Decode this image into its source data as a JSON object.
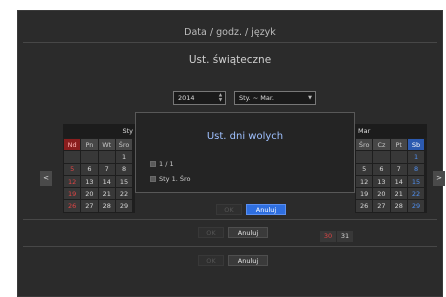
{
  "header": {
    "title": "Data / godz. / język"
  },
  "holiday": {
    "title": "Ust. świąteczne",
    "year": "2014",
    "month_range": "Sty. ~ Mar."
  },
  "cal_left": {
    "month_label": "Sty",
    "weekday_headers": [
      "Nd",
      "Pn",
      "Wt",
      "Śro"
    ],
    "rows": [
      [
        "",
        "",
        "",
        "1"
      ],
      [
        "5",
        "6",
        "7",
        "8"
      ],
      [
        "12",
        "13",
        "14",
        "15"
      ],
      [
        "19",
        "20",
        "21",
        "22"
      ],
      [
        "26",
        "27",
        "28",
        "29"
      ]
    ]
  },
  "cal_right": {
    "month_label": "Mar",
    "weekday_headers": [
      "Śro",
      "Cz",
      "Pt",
      "Sb"
    ],
    "rows": [
      [
        "",
        "",
        "",
        "1"
      ],
      [
        "5",
        "6",
        "7",
        "8"
      ],
      [
        "12",
        "13",
        "14",
        "15"
      ],
      [
        "19",
        "20",
        "21",
        "22"
      ],
      [
        "26",
        "27",
        "28",
        "29"
      ]
    ],
    "extra_days": [
      "30",
      "31"
    ]
  },
  "nav": {
    "prev": "<",
    "next": ">"
  },
  "modal": {
    "title": "Ust. dni wolych",
    "option1": "1 / 1",
    "option2": "Sty 1. Śro",
    "ok": "OK",
    "cancel": "Anuluj"
  },
  "footer1": {
    "ok": "OK",
    "cancel": "Anuluj"
  },
  "footer2": {
    "ok": "OK",
    "cancel": "Anuluj"
  },
  "colors": {
    "accent": "#2f6fe0",
    "holiday_red": "#e04545",
    "saturday_blue": "#4f8ff0"
  }
}
